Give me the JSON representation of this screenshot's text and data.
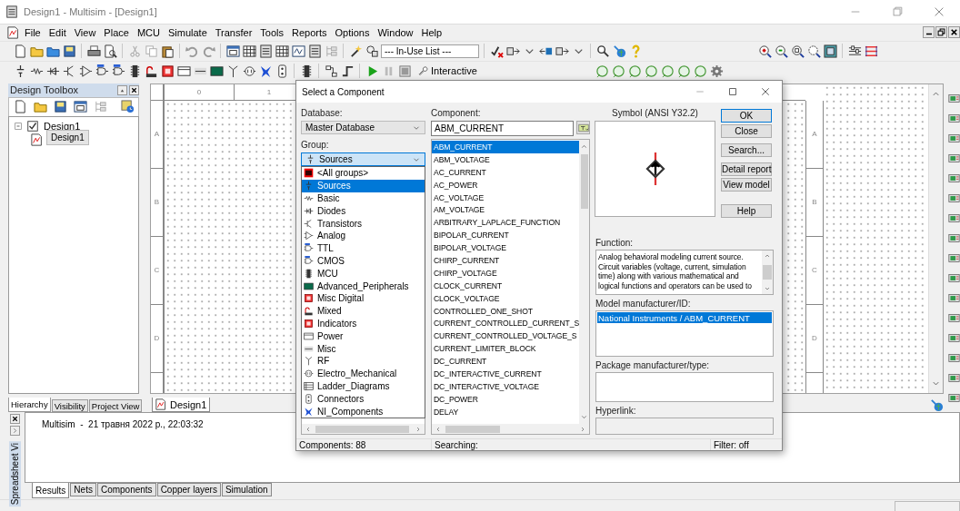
{
  "window": {
    "title": "Design1 - Multisim - [Design1]"
  },
  "menu": [
    "File",
    "Edit",
    "View",
    "Place",
    "MCU",
    "Simulate",
    "Transfer",
    "Tools",
    "Reports",
    "Options",
    "Window",
    "Help"
  ],
  "toolbar": {
    "in_use_list": "--- In-Use List ---",
    "interactive": "Interactive"
  },
  "design_toolbox": {
    "title": "Design Toolbox",
    "tree": [
      {
        "label": "Design1",
        "expanded": true,
        "selected": false,
        "children": [
          {
            "label": "Design1",
            "selected": true
          }
        ]
      }
    ],
    "tabs": [
      {
        "label": "Hierarchy",
        "selected": true
      },
      {
        "label": "Visibility",
        "selected": false
      },
      {
        "label": "Project View",
        "selected": false
      }
    ]
  },
  "canvas": {
    "column_labels": [
      "0",
      "1"
    ],
    "row_labels": [
      "A",
      "B",
      "C",
      "D"
    ],
    "row_labels_right": [
      "A",
      "B",
      "C",
      "D"
    ],
    "tabs": [
      {
        "label": "Design1",
        "selected": true
      }
    ]
  },
  "spreadsheet": {
    "title": "Spreadsheet Vi",
    "log": "Multisim  -  21 травня 2022 р., 22:03:32",
    "tabs": [
      {
        "label": "Results",
        "selected": true
      },
      {
        "label": "Nets",
        "selected": false
      },
      {
        "label": "Components",
        "selected": false
      },
      {
        "label": "Copper layers",
        "selected": false
      },
      {
        "label": "Simulation",
        "selected": false
      }
    ]
  },
  "dialog": {
    "title": "Select a Component",
    "database_label": "Database:",
    "database": "Master Database",
    "group_label": "Group:",
    "group": "Sources",
    "group_options": [
      {
        "label": "<All groups>",
        "selected": false
      },
      {
        "label": "Sources",
        "selected": true
      },
      {
        "label": "Basic",
        "selected": false
      },
      {
        "label": "Diodes",
        "selected": false
      },
      {
        "label": "Transistors",
        "selected": false
      },
      {
        "label": "Analog",
        "selected": false
      },
      {
        "label": "TTL",
        "selected": false
      },
      {
        "label": "CMOS",
        "selected": false
      },
      {
        "label": "MCU",
        "selected": false
      },
      {
        "label": "Advanced_Peripherals",
        "selected": false
      },
      {
        "label": "Misc Digital",
        "selected": false
      },
      {
        "label": "Mixed",
        "selected": false
      },
      {
        "label": "Indicators",
        "selected": false
      },
      {
        "label": "Power",
        "selected": false
      },
      {
        "label": "Misc",
        "selected": false
      },
      {
        "label": "RF",
        "selected": false
      },
      {
        "label": "Electro_Mechanical",
        "selected": false
      },
      {
        "label": "Ladder_Diagrams",
        "selected": false
      },
      {
        "label": "Connectors",
        "selected": false
      },
      {
        "label": "NI_Components",
        "selected": false
      }
    ],
    "component_label": "Component:",
    "component": "ABM_CURRENT",
    "components": [
      {
        "label": "ABM_CURRENT",
        "selected": true
      },
      {
        "label": "ABM_VOLTAGE",
        "selected": false
      },
      {
        "label": "AC_CURRENT",
        "selected": false
      },
      {
        "label": "AC_POWER",
        "selected": false
      },
      {
        "label": "AC_VOLTAGE",
        "selected": false
      },
      {
        "label": "AM_VOLTAGE",
        "selected": false
      },
      {
        "label": "ARBITRARY_LAPLACE_FUNCTION",
        "selected": false
      },
      {
        "label": "BIPOLAR_CURRENT",
        "selected": false
      },
      {
        "label": "BIPOLAR_VOLTAGE",
        "selected": false
      },
      {
        "label": "CHIRP_CURRENT",
        "selected": false
      },
      {
        "label": "CHIRP_VOLTAGE",
        "selected": false
      },
      {
        "label": "CLOCK_CURRENT",
        "selected": false
      },
      {
        "label": "CLOCK_VOLTAGE",
        "selected": false
      },
      {
        "label": "CONTROLLED_ONE_SHOT",
        "selected": false
      },
      {
        "label": "CURRENT_CONTROLLED_CURRENT_S",
        "selected": false
      },
      {
        "label": "CURRENT_CONTROLLED_VOLTAGE_S",
        "selected": false
      },
      {
        "label": "CURRENT_LIMITER_BLOCK",
        "selected": false
      },
      {
        "label": "DC_CURRENT",
        "selected": false
      },
      {
        "label": "DC_INTERACTIVE_CURRENT",
        "selected": false
      },
      {
        "label": "DC_INTERACTIVE_VOLTAGE",
        "selected": false
      },
      {
        "label": "DC_POWER",
        "selected": false
      },
      {
        "label": "DELAY",
        "selected": false
      }
    ],
    "symbol_label": "Symbol (ANSI Y32.2)",
    "buttons": [
      {
        "label": "OK",
        "kind": "default"
      },
      {
        "label": "Close",
        "kind": "normal"
      },
      {
        "label": "Search...",
        "kind": "spaced"
      },
      {
        "label": "Detail report",
        "kind": "spaced"
      },
      {
        "label": "View model",
        "kind": "normal"
      },
      {
        "label": "Help",
        "kind": "separated"
      }
    ],
    "function_label": "Function:",
    "function_text": "Analog behavioral modeling current source. Circuit variables (voltage, current, simulation time) along with various mathematical and logical functions and operators can be used to",
    "model_label": "Model manufacturer/ID:",
    "models": [
      {
        "label": "National Instruments / ABM_CURRENT",
        "selected": true
      }
    ],
    "package_label": "Package manufacturer/type:",
    "hyperlink_label": "Hyperlink:",
    "status": [
      "Components: 88",
      "Searching:",
      "Filter: off"
    ]
  }
}
